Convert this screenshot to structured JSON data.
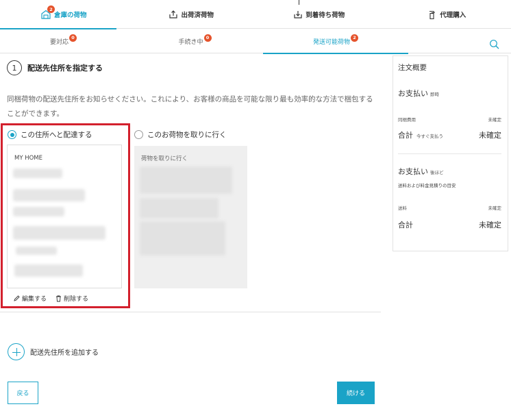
{
  "top_nav": {
    "tabs": [
      {
        "label": "倉庫の荷物",
        "icon": "warehouse-icon",
        "badge": "2",
        "active": true
      },
      {
        "label": "出荷済荷物",
        "icon": "outbox-icon",
        "active": false
      },
      {
        "label": "到着待ち荷物",
        "icon": "inbox-icon",
        "active": false
      },
      {
        "label": "代理購入",
        "icon": "spray-bottle-icon",
        "active": false
      }
    ]
  },
  "sub_nav": {
    "tabs": [
      {
        "label": "要対応",
        "badge": "0"
      },
      {
        "label": "手続き中",
        "badge": "0"
      },
      {
        "label": "発送可能荷物",
        "badge": "2",
        "active": true
      }
    ]
  },
  "step": {
    "number": "1",
    "title": "配送先住所を指定する",
    "description": "同梱荷物の配送先住所をお知らせください。これにより、お客様の商品を可能な限り最も効率的な方法で梱包することができます。"
  },
  "options": {
    "deliver_label": "この住所へと配達する",
    "pickup_label": "このお荷物を取りに行く"
  },
  "address_card": {
    "title": "MY HOME",
    "edit_label": "編集する",
    "delete_label": "削除する"
  },
  "pickup_card": {
    "title": "荷物を取りに行く"
  },
  "add_address_label": "配送先住所を追加する",
  "buttons": {
    "back": "戻る",
    "next": "続ける"
  },
  "summary": {
    "title": "注文概要",
    "pay_now": {
      "heading": "お支払い",
      "heading_note": "即時",
      "item_label": "同梱費用",
      "item_value": "未確定",
      "total_label": "合計",
      "total_note": "今すぐ支払う",
      "total_value": "未確定"
    },
    "pay_later": {
      "heading": "お支払い",
      "heading_note": "後ほど",
      "note": "送料および料金見積りの目安",
      "item_label": "送料",
      "item_value": "未確定",
      "total_label": "合計",
      "total_value": "未確定"
    }
  },
  "colors": {
    "accent": "#1aa3c7",
    "badge": "#e5532c",
    "highlight": "#d3202d"
  }
}
